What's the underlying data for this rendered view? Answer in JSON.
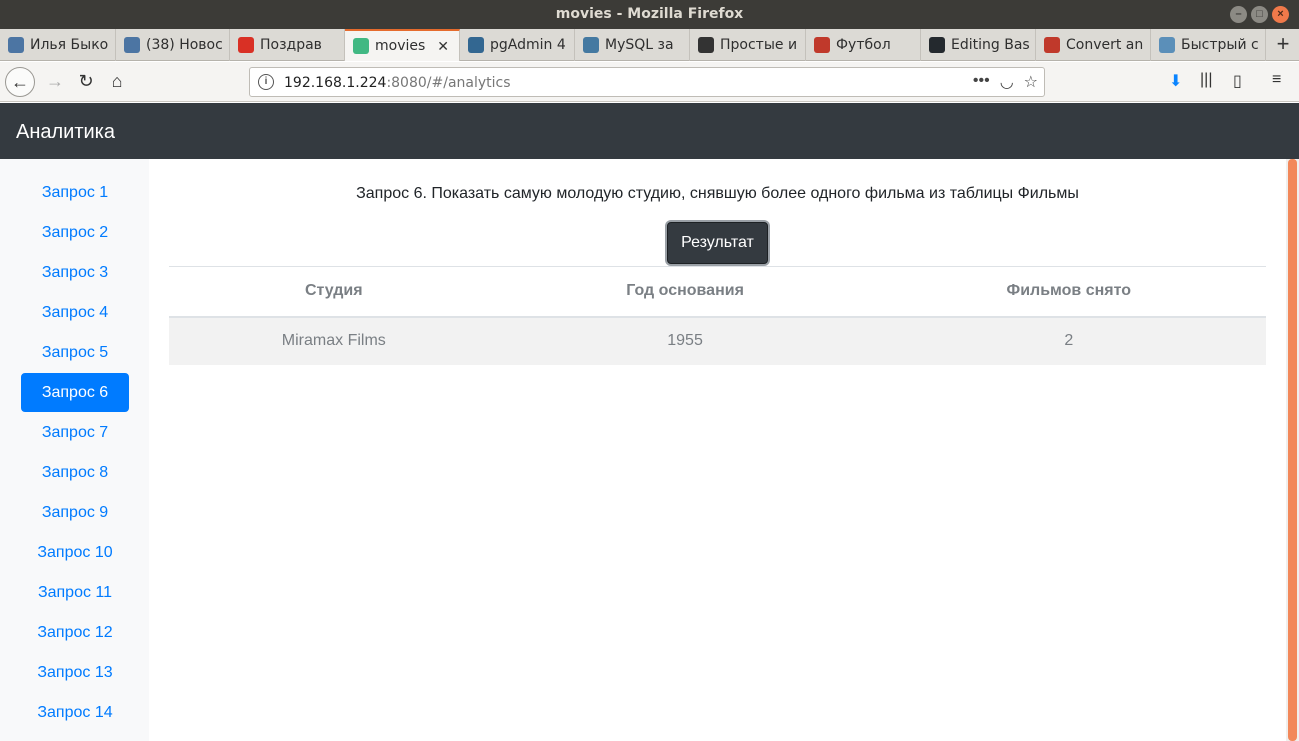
{
  "window": {
    "title": "movies - Mozilla Firefox"
  },
  "tabs": [
    {
      "label": "Илья Быко",
      "icon": "vk-icon",
      "color": "#4c75a3"
    },
    {
      "label": "(38) Новос",
      "icon": "vk-icon",
      "color": "#4c75a3"
    },
    {
      "label": "Поздрав",
      "icon": "gmail-icon",
      "color": "#d93025"
    },
    {
      "label": "movies",
      "icon": "vue-icon",
      "color": "#41b883",
      "active": true
    },
    {
      "label": "pgAdmin 4",
      "icon": "pgadmin-icon",
      "color": "#336791"
    },
    {
      "label": "MySQL за",
      "icon": "mysql-icon",
      "color": "#4479a1"
    },
    {
      "label": "Простые и",
      "icon": "habr-icon",
      "color": "#333333"
    },
    {
      "label": "Футбол",
      "icon": "football-icon",
      "color": "#c0392b"
    },
    {
      "label": "Editing Bas",
      "icon": "github-icon",
      "color": "#24292e"
    },
    {
      "label": "Convert an",
      "icon": "convert-icon",
      "color": "#c0392b"
    },
    {
      "label": "Быстрый с",
      "icon": "habr-h-icon",
      "color": "#5b8fb9"
    }
  ],
  "navbar": {
    "url_host": "192.168.1.224",
    "url_rest": ":8080/#/analytics"
  },
  "app": {
    "brand": "Аналитика",
    "sidebar": [
      "Запрос 1",
      "Запрос 2",
      "Запрос 3",
      "Запрос 4",
      "Запрос 5",
      "Запрос 6",
      "Запрос 7",
      "Запрос 8",
      "Запрос 9",
      "Запрос 10",
      "Запрос 11",
      "Запрос 12",
      "Запрос 13",
      "Запрос 14"
    ],
    "active_index": 5,
    "query_title": "Запрос 6. Показать самую молодую студию, снявшую более одного фильма из таблицы Фильмы",
    "result_button": "Результат",
    "table": {
      "headers": [
        "Студия",
        "Год основания",
        "Фильмов снято"
      ],
      "rows": [
        [
          "Miramax Films",
          "1955",
          "2"
        ]
      ]
    }
  },
  "colors": {
    "primary": "#007bff",
    "dark": "#343a40",
    "scroll_thumb": "#f2885a"
  }
}
